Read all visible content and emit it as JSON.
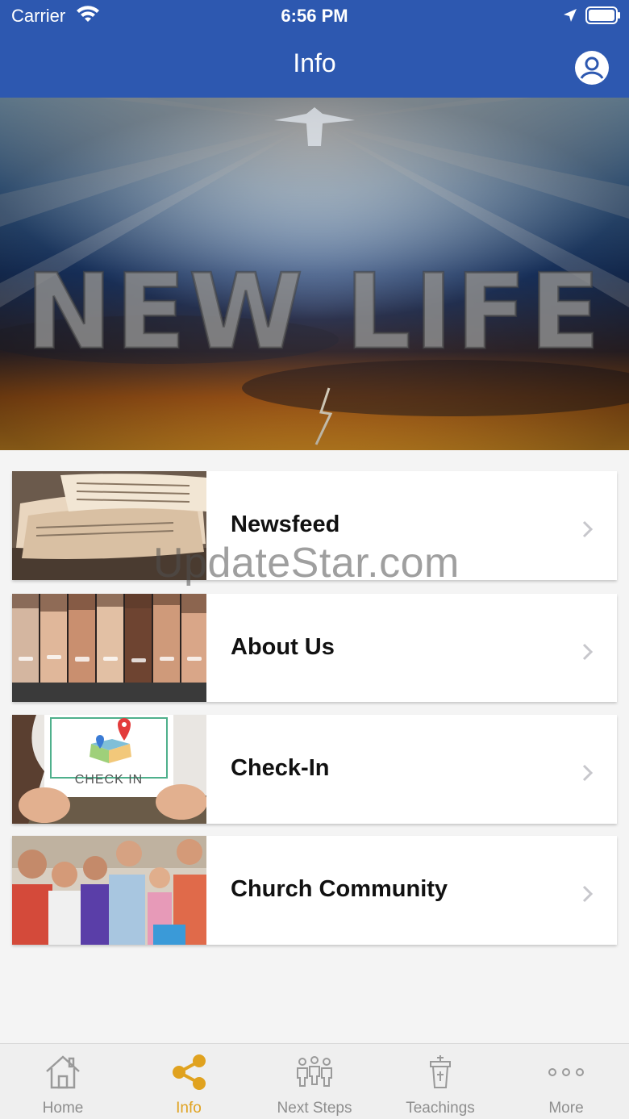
{
  "status_bar": {
    "carrier": "Carrier",
    "time": "6:56 PM"
  },
  "header": {
    "title": "Info"
  },
  "hero": {
    "title": "NEW LIFE"
  },
  "menu": [
    {
      "label": "Newsfeed"
    },
    {
      "label": "About Us"
    },
    {
      "label": "Check-In",
      "thumb_caption": "CHECK IN"
    },
    {
      "label": "Church Community"
    }
  ],
  "watermark": "UpdateStar.com",
  "tabs": [
    {
      "label": "Home",
      "icon": "home-icon"
    },
    {
      "label": "Info",
      "icon": "share-icon",
      "active": true
    },
    {
      "label": "Next Steps",
      "icon": "people-icon"
    },
    {
      "label": "Teachings",
      "icon": "pulpit-icon"
    },
    {
      "label": "More",
      "icon": "more-icon"
    }
  ],
  "colors": {
    "header": "#2d58b0",
    "tab_active": "#e0a21f",
    "tab_inactive": "#8e8e8e"
  }
}
